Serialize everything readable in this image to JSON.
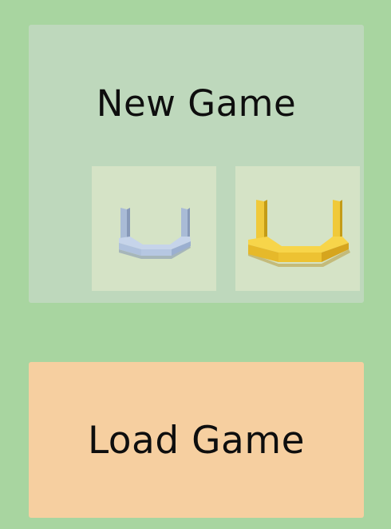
{
  "new_game": {
    "title": "New Game",
    "options": [
      {
        "icon": "blue-basket-icon",
        "color": "#b3c6e0"
      },
      {
        "icon": "yellow-basket-icon",
        "color": "#f0c93a"
      }
    ]
  },
  "load_game": {
    "label": "Load Game",
    "color": "#f6cfa0"
  },
  "colors": {
    "background": "#a8d5a0",
    "panel": "#bed8bc",
    "card": "#d5e3c6"
  }
}
